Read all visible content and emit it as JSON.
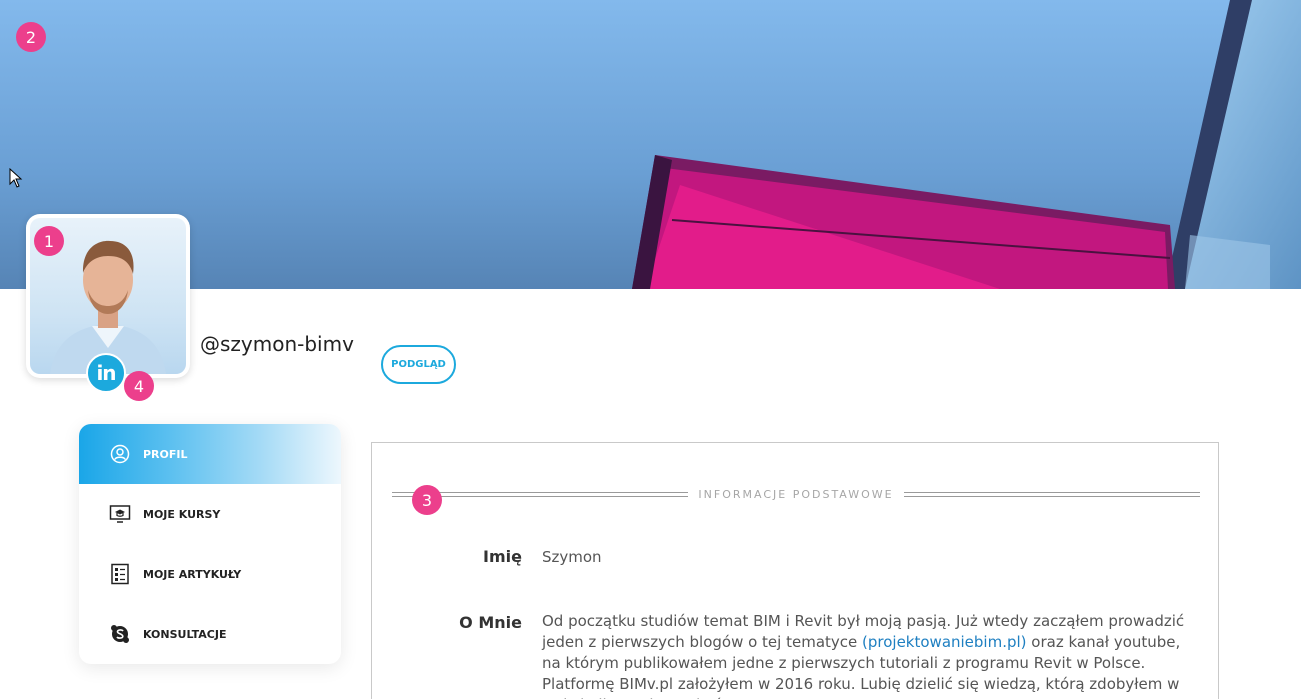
{
  "markers": [
    "1",
    "2",
    "3",
    "4"
  ],
  "profile": {
    "username": "@szymon-bimv",
    "preview_label": "PODGLĄD",
    "linkedin_text": "in"
  },
  "menu": {
    "items": [
      {
        "label": "PROFIL",
        "icon": "user-circle-icon",
        "active": true
      },
      {
        "label": "MOJE KURSY",
        "icon": "monitor-graduation-icon",
        "active": false
      },
      {
        "label": "MOJE ARTYKUŁY",
        "icon": "article-list-icon",
        "active": false
      },
      {
        "label": "KONSULTACJE",
        "icon": "skype-icon",
        "active": false
      }
    ]
  },
  "section": {
    "title": "INFORMACJE PODSTAWOWE",
    "name_label": "Imię",
    "name_value": "Szymon",
    "about_label": "O Mnie",
    "about_before": "Od początku studiów temat BIM i Revit był moją pasją. Już wtedy zacząłem prowadzić jeden z pierwszych blogów o tej tematyce ",
    "about_link": "(projektowaniebim.pl)",
    "about_after": " oraz kanał youtube, na którym publikowałem jedne z pierwszych tutoriali z programu Revit w Polsce. Platformę BIMv.pl założyłem w 2016 roku. Lubię dzielić się wiedzą, którą zdobyłem w trakcie licznych spotkań z"
  },
  "colors": {
    "accent": "#1ca9dd",
    "marker": "#ec3f8c",
    "link": "#1e7fc1"
  }
}
